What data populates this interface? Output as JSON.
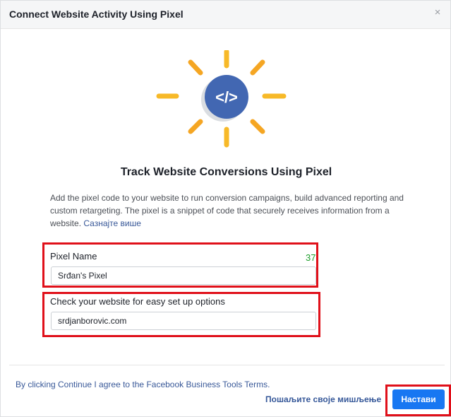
{
  "dialog": {
    "title": "Connect Website Activity Using Pixel",
    "close_symbol": "×"
  },
  "illustration": {
    "icon": "code-brackets-icon",
    "glyph": "</>",
    "colors": {
      "ray": "#f7b928",
      "ray_alt": "#f5a623",
      "circle": "#4267b2",
      "shadow": "#dadde1"
    }
  },
  "content": {
    "heading": "Track Website Conversions Using Pixel",
    "description": "Add the pixel code to your website to run conversion campaigns, build advanced reporting and custom retargeting. The pixel is a snippet of code that securely receives information from a website. ",
    "learn_more": "Сазнајте више"
  },
  "pixel_name": {
    "label": "Pixel Name",
    "counter": "37",
    "value": "Srđan's Pixel"
  },
  "website": {
    "label": "Check your website for easy set up options",
    "value": "srdjanborovic.com"
  },
  "footer": {
    "terms": "By clicking Continue I agree to the Facebook Business Tools Terms.",
    "feedback_link": "Пошаљите своје мишљење",
    "continue_label": "Настави"
  },
  "colors": {
    "highlight": "#e0101a",
    "primary_button": "#1877f2",
    "link": "#385898",
    "counter": "#1d9d2a"
  }
}
